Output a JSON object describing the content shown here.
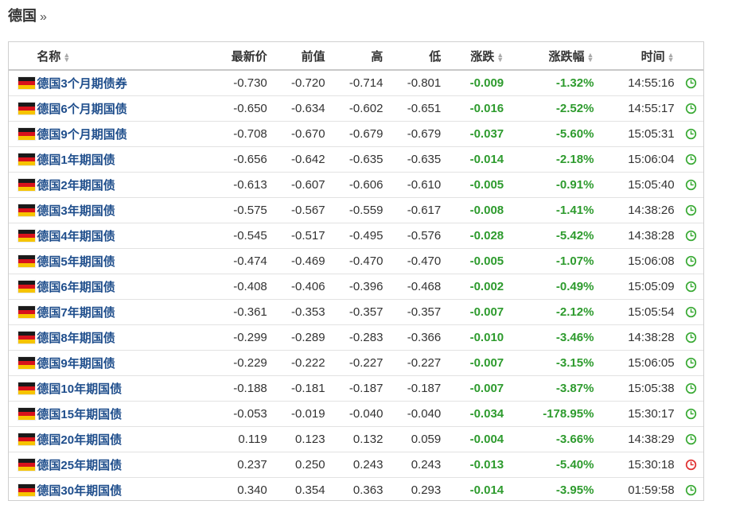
{
  "page": {
    "title": "德国",
    "title_suffix": "»"
  },
  "colors": {
    "name_link": "#1f4e8c",
    "negative_change": "#2e9b2e",
    "clock_open": "#3aaa35",
    "clock_closed": "#e03030"
  },
  "table": {
    "headers": {
      "name": "名称",
      "last": "最新价",
      "prev": "前值",
      "high": "高",
      "low": "低",
      "chg": "涨跌",
      "chg_pct": "涨跌幅",
      "time": "时间"
    },
    "sort_icon": "sort-arrows-icon",
    "flag_icon": "germany-flag-icon",
    "rows": [
      {
        "name": "德国3个月期债券",
        "last": "-0.730",
        "prev": "-0.720",
        "high": "-0.714",
        "low": "-0.801",
        "chg": "-0.009",
        "chg_pct": "-1.32%",
        "time": "14:55:16",
        "status": "open"
      },
      {
        "name": "德国6个月期国债",
        "last": "-0.650",
        "prev": "-0.634",
        "high": "-0.602",
        "low": "-0.651",
        "chg": "-0.016",
        "chg_pct": "-2.52%",
        "time": "14:55:17",
        "status": "open"
      },
      {
        "name": "德国9个月期国债",
        "last": "-0.708",
        "prev": "-0.670",
        "high": "-0.679",
        "low": "-0.679",
        "chg": "-0.037",
        "chg_pct": "-5.60%",
        "time": "15:05:31",
        "status": "open"
      },
      {
        "name": "德国1年期国债",
        "last": "-0.656",
        "prev": "-0.642",
        "high": "-0.635",
        "low": "-0.635",
        "chg": "-0.014",
        "chg_pct": "-2.18%",
        "time": "15:06:04",
        "status": "open"
      },
      {
        "name": "德国2年期国债",
        "last": "-0.613",
        "prev": "-0.607",
        "high": "-0.606",
        "low": "-0.610",
        "chg": "-0.005",
        "chg_pct": "-0.91%",
        "time": "15:05:40",
        "status": "open"
      },
      {
        "name": "德国3年期国债",
        "last": "-0.575",
        "prev": "-0.567",
        "high": "-0.559",
        "low": "-0.617",
        "chg": "-0.008",
        "chg_pct": "-1.41%",
        "time": "14:38:26",
        "status": "open"
      },
      {
        "name": "德国4年期国债",
        "last": "-0.545",
        "prev": "-0.517",
        "high": "-0.495",
        "low": "-0.576",
        "chg": "-0.028",
        "chg_pct": "-5.42%",
        "time": "14:38:28",
        "status": "open"
      },
      {
        "name": "德国5年期国债",
        "last": "-0.474",
        "prev": "-0.469",
        "high": "-0.470",
        "low": "-0.470",
        "chg": "-0.005",
        "chg_pct": "-1.07%",
        "time": "15:06:08",
        "status": "open"
      },
      {
        "name": "德国6年期国债",
        "last": "-0.408",
        "prev": "-0.406",
        "high": "-0.396",
        "low": "-0.468",
        "chg": "-0.002",
        "chg_pct": "-0.49%",
        "time": "15:05:09",
        "status": "open"
      },
      {
        "name": "德国7年期国债",
        "last": "-0.361",
        "prev": "-0.353",
        "high": "-0.357",
        "low": "-0.357",
        "chg": "-0.007",
        "chg_pct": "-2.12%",
        "time": "15:05:54",
        "status": "open"
      },
      {
        "name": "德国8年期国债",
        "last": "-0.299",
        "prev": "-0.289",
        "high": "-0.283",
        "low": "-0.366",
        "chg": "-0.010",
        "chg_pct": "-3.46%",
        "time": "14:38:28",
        "status": "open"
      },
      {
        "name": "德国9年期国债",
        "last": "-0.229",
        "prev": "-0.222",
        "high": "-0.227",
        "low": "-0.227",
        "chg": "-0.007",
        "chg_pct": "-3.15%",
        "time": "15:06:05",
        "status": "open"
      },
      {
        "name": "德国10年期国债",
        "last": "-0.188",
        "prev": "-0.181",
        "high": "-0.187",
        "low": "-0.187",
        "chg": "-0.007",
        "chg_pct": "-3.87%",
        "time": "15:05:38",
        "status": "open"
      },
      {
        "name": "德国15年期国债",
        "last": "-0.053",
        "prev": "-0.019",
        "high": "-0.040",
        "low": "-0.040",
        "chg": "-0.034",
        "chg_pct": "-178.95%",
        "time": "15:30:17",
        "status": "open"
      },
      {
        "name": "德国20年期国债",
        "last": "0.119",
        "prev": "0.123",
        "high": "0.132",
        "low": "0.059",
        "chg": "-0.004",
        "chg_pct": "-3.66%",
        "time": "14:38:29",
        "status": "open"
      },
      {
        "name": "德国25年期国债",
        "last": "0.237",
        "prev": "0.250",
        "high": "0.243",
        "low": "0.243",
        "chg": "-0.013",
        "chg_pct": "-5.40%",
        "time": "15:30:18",
        "status": "closed"
      },
      {
        "name": "德国30年期国债",
        "last": "0.340",
        "prev": "0.354",
        "high": "0.363",
        "low": "0.293",
        "chg": "-0.014",
        "chg_pct": "-3.95%",
        "time": "01:59:58",
        "status": "open"
      }
    ]
  }
}
